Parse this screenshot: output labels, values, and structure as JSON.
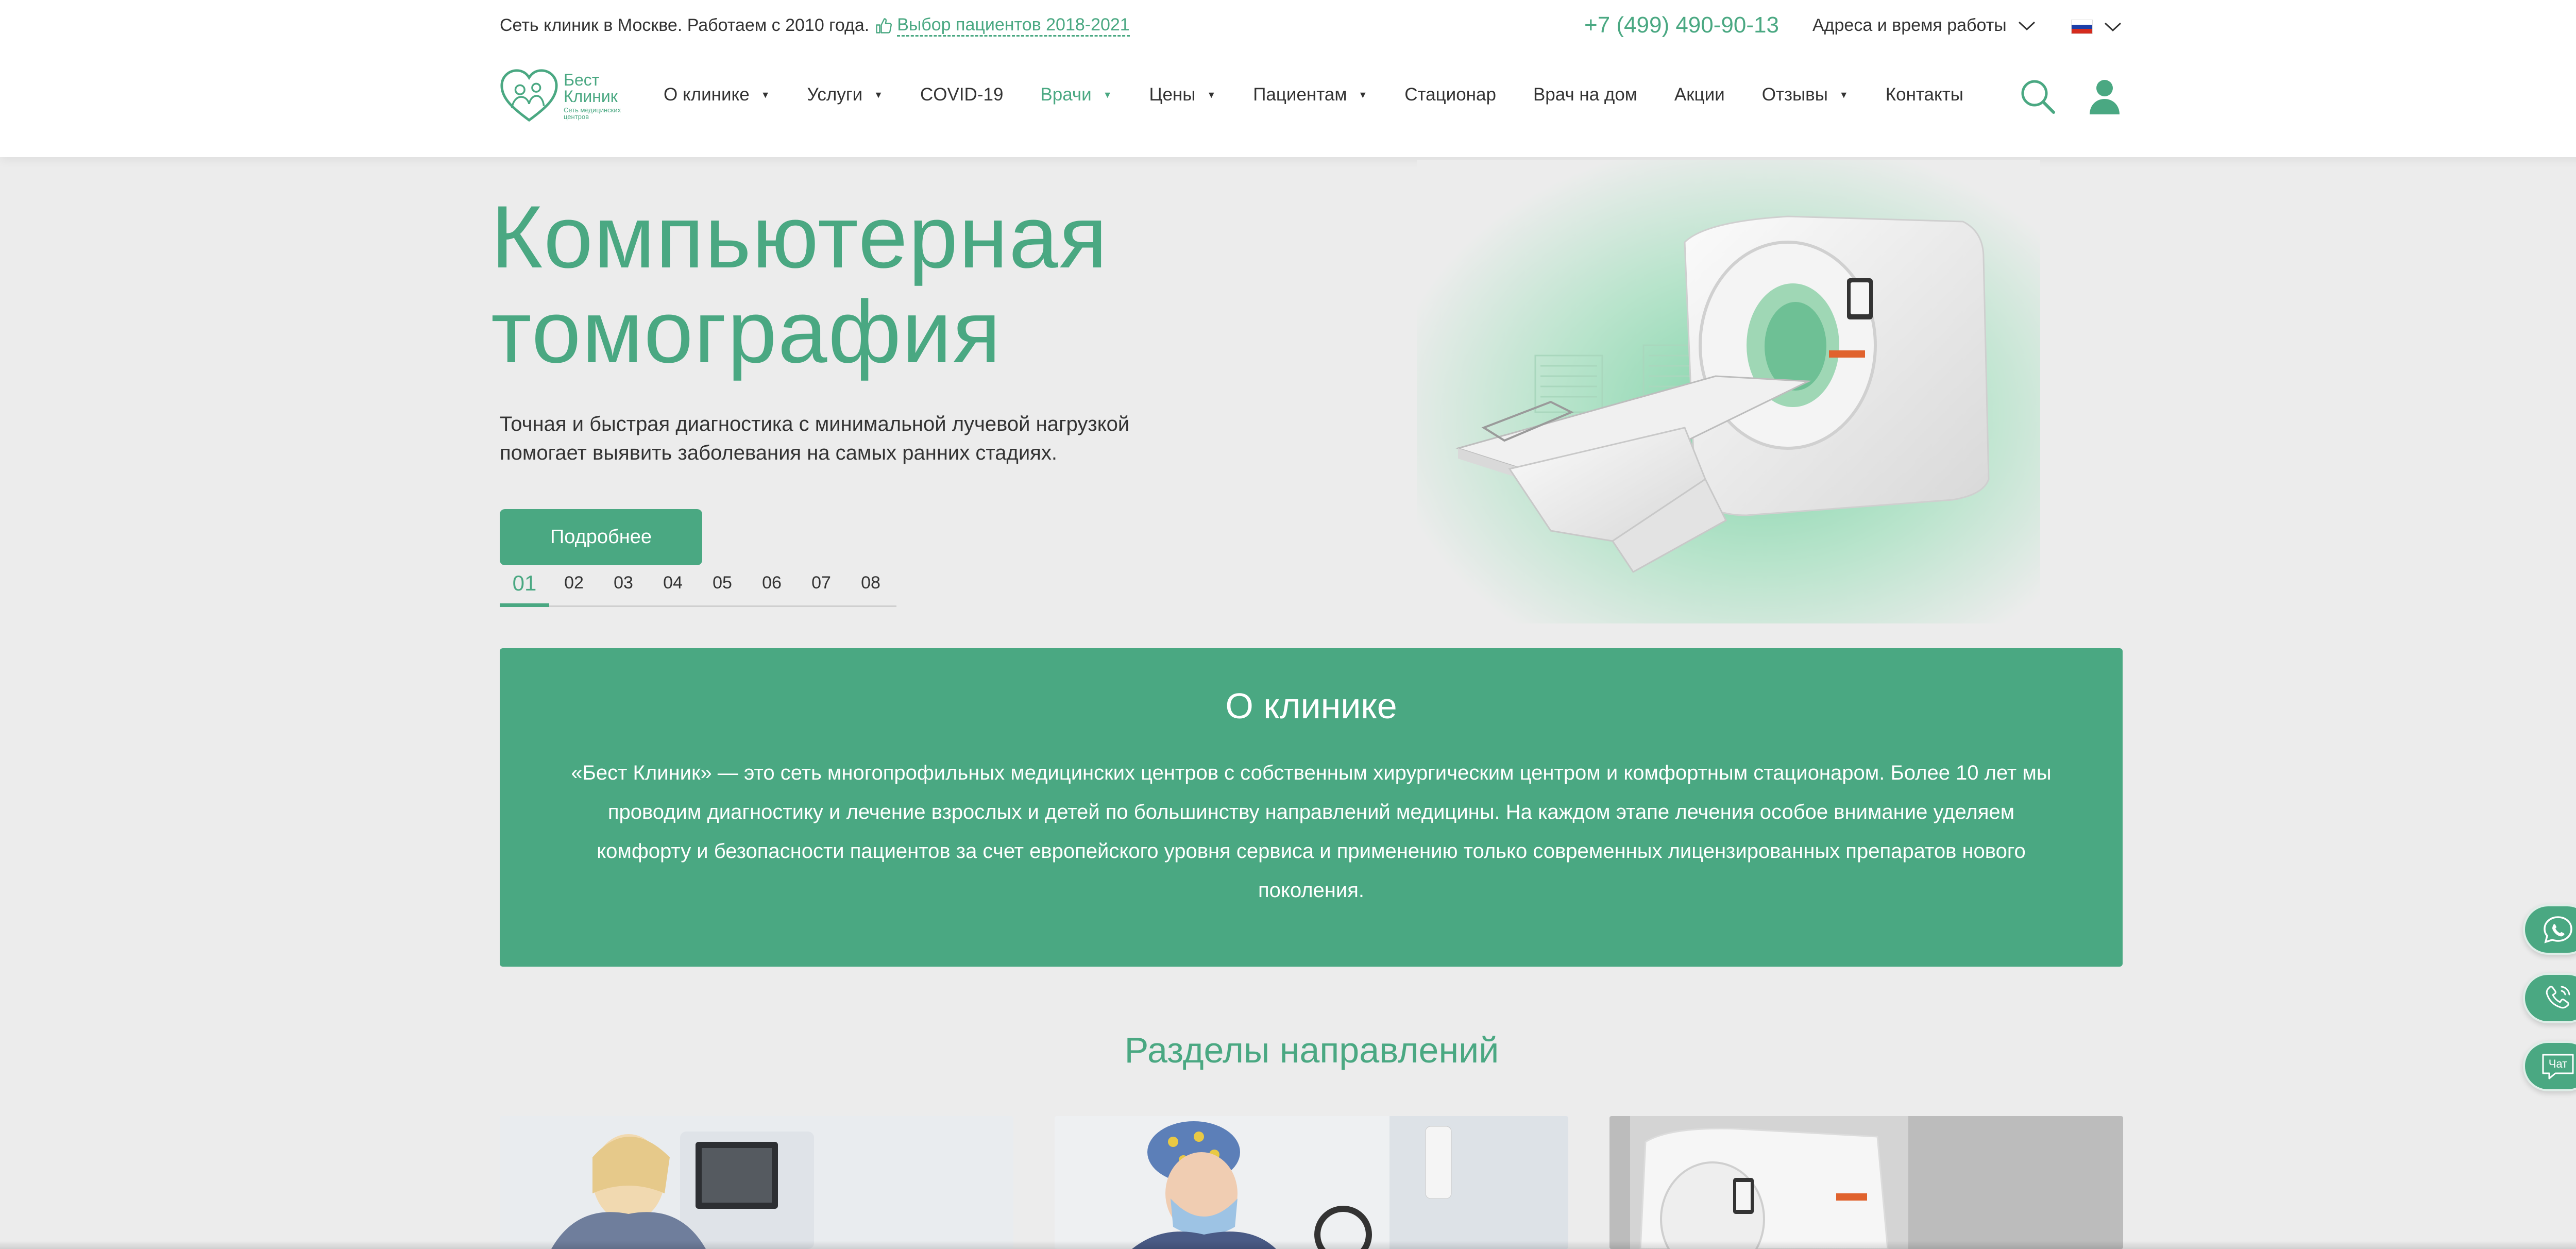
{
  "header": {
    "tagline": "Сеть клиник в Москве. Работаем с 2010 года.",
    "award_link": "Выбор пациентов 2018-2021",
    "phone": "+7 (499) 490-90-13",
    "addresses_label": "Адреса и время работы",
    "language": "ru",
    "logo": {
      "line1": "Бест",
      "line2": "Клиник",
      "line3": "Сеть медицинских центров"
    }
  },
  "nav": {
    "items": [
      {
        "label": "О клинике",
        "has_dropdown": true,
        "active": false
      },
      {
        "label": "Услуги",
        "has_dropdown": true,
        "active": false
      },
      {
        "label": "COVID-19",
        "has_dropdown": false,
        "active": false
      },
      {
        "label": "Врачи",
        "has_dropdown": true,
        "active": true
      },
      {
        "label": "Цены",
        "has_dropdown": true,
        "active": false
      },
      {
        "label": "Пациентам",
        "has_dropdown": true,
        "active": false
      },
      {
        "label": "Стационар",
        "has_dropdown": false,
        "active": false
      },
      {
        "label": "Врач на дом",
        "has_dropdown": false,
        "active": false
      },
      {
        "label": "Акции",
        "has_dropdown": false,
        "active": false
      },
      {
        "label": "Отзывы",
        "has_dropdown": true,
        "active": false
      },
      {
        "label": "Контакты",
        "has_dropdown": false,
        "active": false
      }
    ],
    "search_icon": "search-icon",
    "user_icon": "user-icon"
  },
  "hero": {
    "title_line1": "Компьютерная",
    "title_line2": "томография",
    "text_line1": "Точная и быстрая диагностика с минимальной лучевой нагрузкой",
    "text_line2": "помогает выявить заболевания на самых ранних стадиях.",
    "button_label": "Подробнее",
    "slides": [
      "01",
      "02",
      "03",
      "04",
      "05",
      "06",
      "07",
      "08"
    ],
    "active_slide": "01"
  },
  "about": {
    "title": "О клинике",
    "text": "«Бест Клиник» — это сеть многопрофильных медицинских центров с собственным хирургическим центром и комфортным стационаром. Более 10 лет мы проводим диагностику и лечение взрослых и детей по большинству направлений медицины. На каждом этапе лечения особое внимание уделяем комфорту и безопасности пациентов за счет европейского уровня сервиса и применению только современных лицензированных препаратов нового поколения."
  },
  "sections": {
    "title": "Разделы направлений"
  },
  "floating": {
    "whatsapp_icon": "whatsapp-icon",
    "phone_icon": "phone-icon",
    "chat_label": "Чат"
  },
  "colors": {
    "accent": "#4aa882",
    "background": "#ececec",
    "text": "#333333"
  }
}
